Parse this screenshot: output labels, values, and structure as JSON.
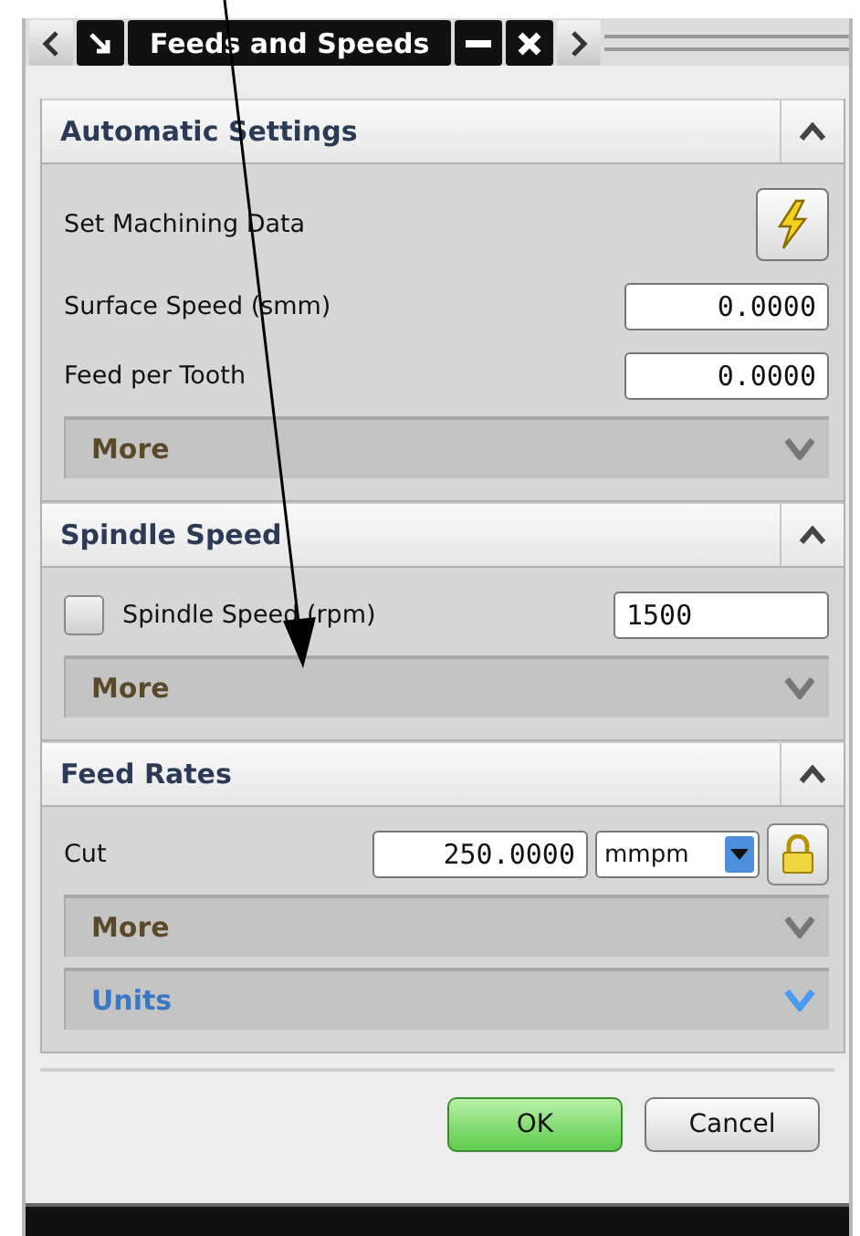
{
  "window": {
    "title": "Feeds and Speeds"
  },
  "sections": [
    {
      "title": "Automatic Settings",
      "expanded": true,
      "rows": [
        {
          "kind": "action",
          "label": "Set Machining Data"
        },
        {
          "kind": "field",
          "label": "Surface Speed (smm)",
          "value": "0.0000"
        },
        {
          "kind": "field",
          "label": "Feed per Tooth",
          "value": "0.0000"
        },
        {
          "kind": "group",
          "label": "More",
          "expanded": false,
          "highlighted": false
        }
      ]
    },
    {
      "title": "Spindle Speed",
      "expanded": true,
      "rows": [
        {
          "kind": "check_field",
          "label": "Spindle Speed (rpm)",
          "checked": false,
          "value": "1500"
        },
        {
          "kind": "group",
          "label": "More",
          "expanded": false,
          "highlighted": false
        }
      ]
    },
    {
      "title": "Feed Rates",
      "expanded": true,
      "rows": [
        {
          "kind": "rate",
          "label": "Cut",
          "value": "250.0000",
          "unit": "mmpm"
        },
        {
          "kind": "group",
          "label": "More",
          "expanded": false,
          "highlighted": false
        },
        {
          "kind": "group",
          "label": "Units",
          "expanded": false,
          "highlighted": true
        }
      ]
    }
  ],
  "buttons": [
    {
      "label": "OK",
      "default": true
    },
    {
      "label": "Cancel",
      "default": false
    }
  ]
}
